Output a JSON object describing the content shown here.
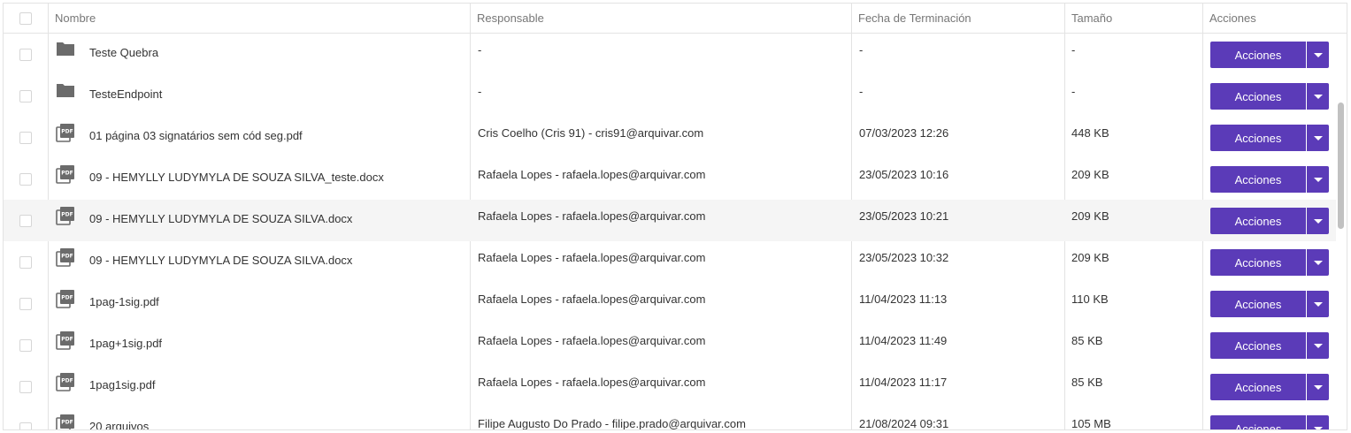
{
  "columns": {
    "name": "Nombre",
    "responsible": "Responsable",
    "finish_date": "Fecha de Terminación",
    "size": "Tamaño",
    "actions": "Acciones"
  },
  "action_label": "Acciones",
  "colors": {
    "accent": "#5b3bb8",
    "folder": "#6b6b6b",
    "row_highlight": "#f5f5f5"
  },
  "rows": [
    {
      "type": "folder",
      "name": "Teste Quebra",
      "responsible": "-",
      "date": "-",
      "size": "-"
    },
    {
      "type": "folder",
      "name": "TesteEndpoint",
      "responsible": "-",
      "date": "-",
      "size": "-"
    },
    {
      "type": "pdf",
      "name": "01 página 03 signatários sem cód seg.pdf",
      "responsible": "Cris Coelho (Cris 91) - cris91@arquivar.com",
      "date": "07/03/2023 12:26",
      "size": "448 KB"
    },
    {
      "type": "pdf",
      "name": "09 - HEMYLLY LUDYMYLA DE SOUZA SILVA_teste.docx",
      "responsible": "Rafaela Lopes - rafaela.lopes@arquivar.com",
      "date": "23/05/2023 10:16",
      "size": "209 KB"
    },
    {
      "type": "pdf",
      "name": "09 - HEMYLLY LUDYMYLA DE SOUZA SILVA.docx",
      "responsible": "Rafaela Lopes - rafaela.lopes@arquivar.com",
      "date": "23/05/2023 10:21",
      "size": "209 KB",
      "highlighted": true
    },
    {
      "type": "pdf",
      "name": "09 - HEMYLLY LUDYMYLA DE SOUZA SILVA.docx",
      "responsible": "Rafaela Lopes - rafaela.lopes@arquivar.com",
      "date": "23/05/2023 10:32",
      "size": "209 KB"
    },
    {
      "type": "pdf",
      "name": "1pag-1sig.pdf",
      "responsible": "Rafaela Lopes - rafaela.lopes@arquivar.com",
      "date": "11/04/2023 11:13",
      "size": "110 KB"
    },
    {
      "type": "pdf",
      "name": "1pag+1sig.pdf",
      "responsible": "Rafaela Lopes - rafaela.lopes@arquivar.com",
      "date": "11/04/2023 11:49",
      "size": "85 KB"
    },
    {
      "type": "pdf",
      "name": "1pag1sig.pdf",
      "responsible": "Rafaela Lopes - rafaela.lopes@arquivar.com",
      "date": "11/04/2023 11:17",
      "size": "85 KB"
    },
    {
      "type": "pdf",
      "name": "20 arquivos",
      "responsible": "Filipe Augusto Do Prado - filipe.prado@arquivar.com",
      "date": "21/08/2024 09:31",
      "size": "105 MB"
    }
  ],
  "icons": {
    "folder": "folder-icon",
    "pdf": "pdf-file-icon",
    "dropdown": "caret-down-icon"
  }
}
